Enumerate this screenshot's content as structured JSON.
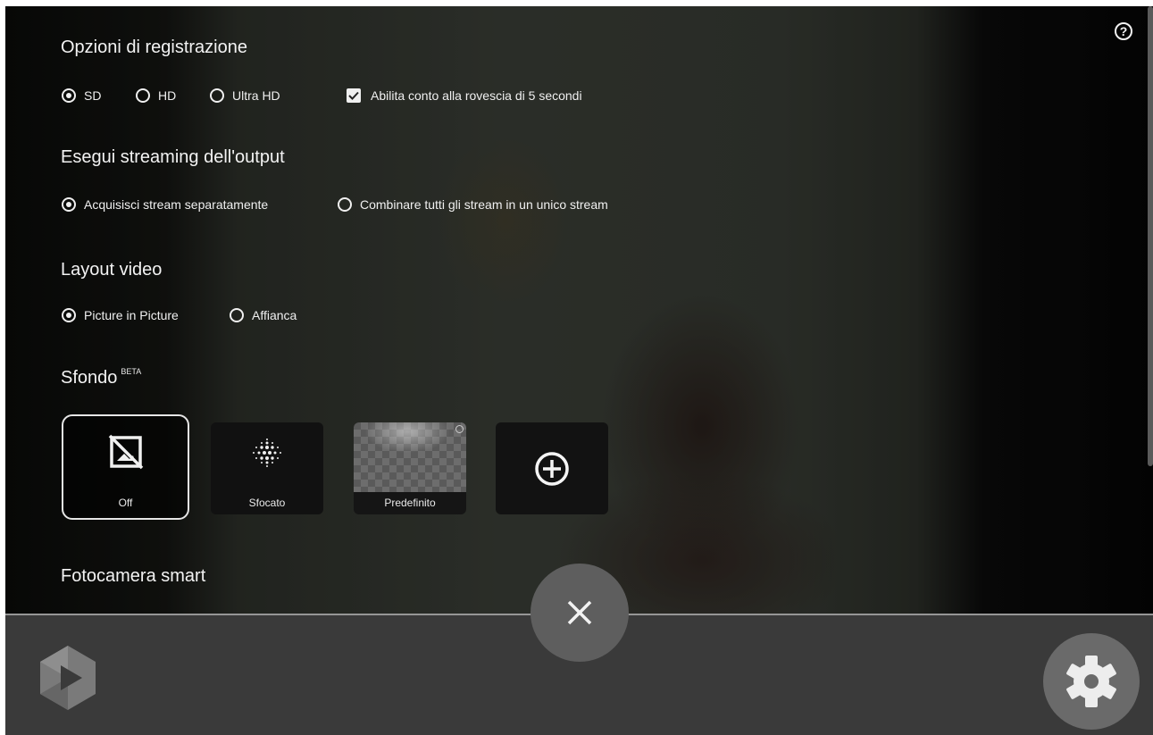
{
  "help": {
    "glyph": "?"
  },
  "recording": {
    "title": "Opzioni di registrazione",
    "qualities": [
      {
        "label": "SD",
        "selected": true
      },
      {
        "label": "HD",
        "selected": false
      },
      {
        "label": "Ultra HD",
        "selected": false
      }
    ],
    "countdown": {
      "label": "Abilita conto alla rovescia di 5 secondi",
      "checked": true
    }
  },
  "streaming": {
    "title": "Esegui streaming dell'output",
    "options": [
      {
        "label": "Acquisisci stream separatamente",
        "selected": true
      },
      {
        "label": "Combinare tutti gli stream in un unico stream",
        "selected": false
      }
    ]
  },
  "layout": {
    "title": "Layout video",
    "options": [
      {
        "label": "Picture in Picture",
        "selected": true
      },
      {
        "label": "Affianca",
        "selected": false
      }
    ]
  },
  "background": {
    "title": "Sfondo",
    "badge": "BETA",
    "tiles": [
      {
        "label": "Off",
        "icon": "no-image-icon",
        "selected": true
      },
      {
        "label": "Sfocato",
        "icon": "blur-dots-icon",
        "selected": false
      },
      {
        "label": "Predefinito",
        "icon": "checker-image",
        "selected": false
      },
      {
        "label": "",
        "icon": "add-circle-icon",
        "selected": false
      }
    ]
  },
  "smart_camera": {
    "title": "Fotocamera smart"
  },
  "bottom_bar": {
    "close_icon": "close-icon",
    "logo_icon": "app-logo-icon",
    "settings_icon": "gear-icon"
  }
}
